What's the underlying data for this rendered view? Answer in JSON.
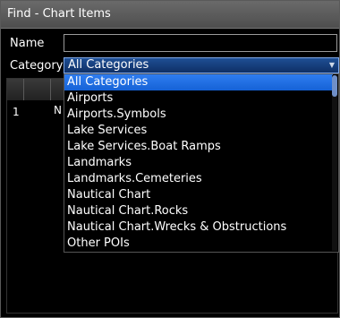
{
  "window": {
    "title": "Find - Chart Items"
  },
  "form": {
    "name_label": "Name",
    "name_value": "",
    "category_label": "Category",
    "category_value": "All Categories"
  },
  "grid": {
    "rows": [
      {
        "number": "1",
        "cell": "N"
      }
    ]
  },
  "dropdown": {
    "options": [
      "All Categories",
      "Airports",
      "Airports.Symbols",
      "Lake Services",
      "Lake Services.Boat Ramps",
      "Landmarks",
      "Landmarks.Cemeteries",
      "Nautical Chart",
      "Nautical Chart.Rocks",
      "Nautical Chart.Wrecks & Obstructions",
      "Other POIs"
    ],
    "selected_index": 0
  },
  "colors": {
    "selection": "#1f6be0",
    "title_bar": "#5a5a5a",
    "background": "#000000"
  }
}
